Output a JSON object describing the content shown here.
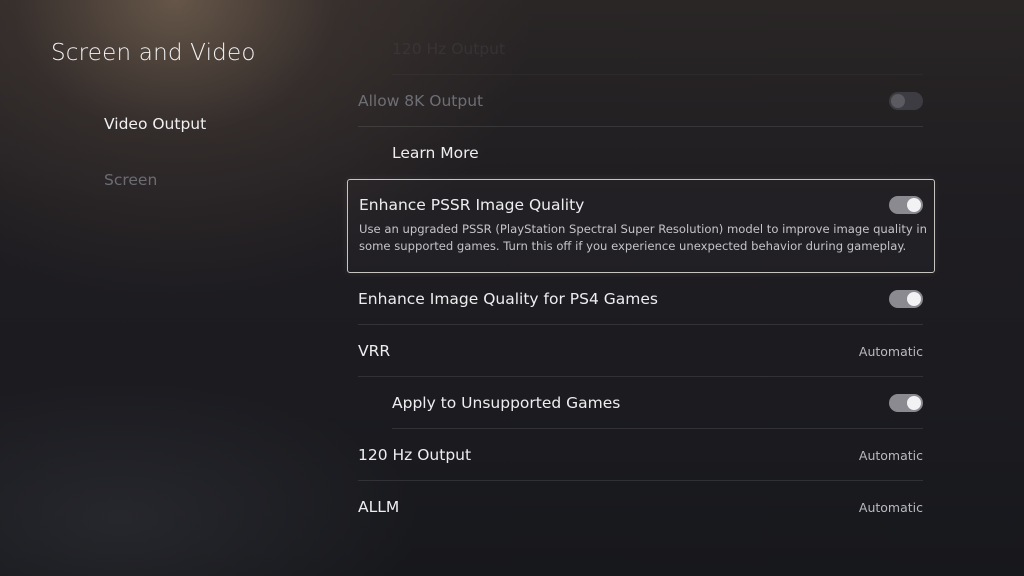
{
  "page": {
    "title": "Screen and Video"
  },
  "nav": {
    "items": [
      {
        "label": "Video Output",
        "active": true
      },
      {
        "label": "Screen",
        "active": false
      }
    ]
  },
  "settings": {
    "rows": [
      {
        "label": "120 Hz Output",
        "state": "cut-off"
      },
      {
        "label": "Allow 8K Output",
        "control": "toggle",
        "toggle": "off",
        "state": "disabled"
      },
      {
        "label": "Learn More",
        "control": "link"
      },
      {
        "label": "Enhance PSSR Image Quality",
        "control": "toggle",
        "toggle": "on",
        "focused": true,
        "description": "Use an upgraded PSSR (PlayStation Spectral Super Resolution) model to improve image quality in some supported games. Turn this off if you experience unexpected behavior during gameplay."
      },
      {
        "label": "Enhance Image Quality for PS4 Games",
        "control": "toggle",
        "toggle": "on"
      },
      {
        "label": "VRR",
        "value": "Automatic"
      },
      {
        "label": "Apply to Unsupported Games",
        "control": "toggle",
        "toggle": "on"
      },
      {
        "label": "120 Hz Output",
        "value": "Automatic"
      },
      {
        "label": "ALLM",
        "value": "Automatic"
      }
    ]
  },
  "colors": {
    "accent_toggle_on": "#8a8a90",
    "focus_border": "#c8c4c0"
  }
}
